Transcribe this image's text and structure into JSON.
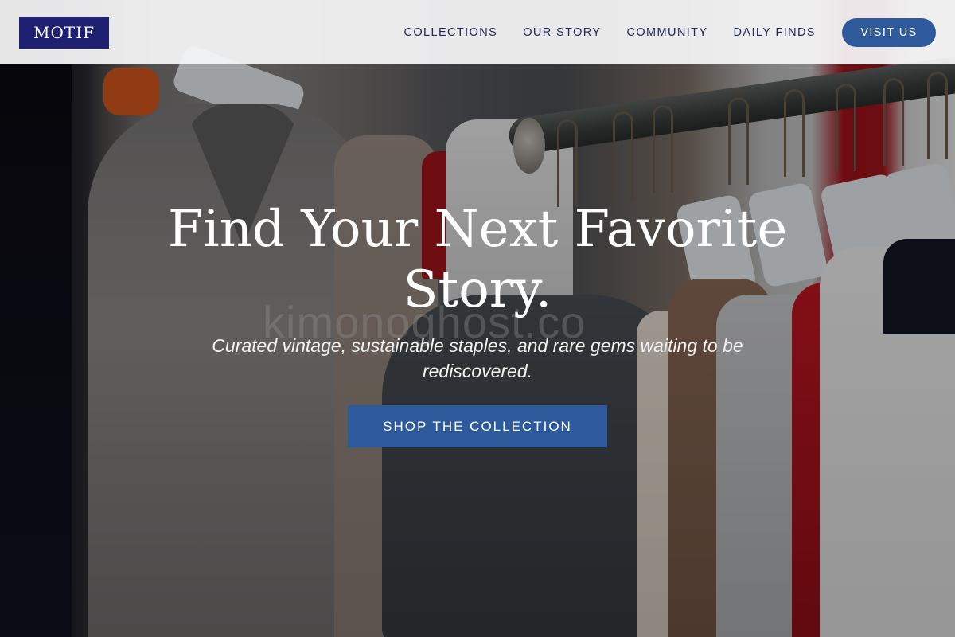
{
  "brand": {
    "logo_text": "MOTIF"
  },
  "nav": {
    "items": [
      {
        "label": "COLLECTIONS"
      },
      {
        "label": "OUR STORY"
      },
      {
        "label": "COMMUNITY"
      },
      {
        "label": "DAILY FINDS"
      }
    ],
    "cta_label": "VISIT US"
  },
  "hero": {
    "title": "Find Your Next Favorite Story.",
    "subtitle": "Curated vintage, sustainable staples, and rare gems waiting to be rediscovered.",
    "cta_label": "SHOP THE COLLECTION",
    "watermark": "kimonoghost.co"
  },
  "colors": {
    "brand_navy": "#1f2072",
    "accent_blue": "#2e5a9c",
    "header_bg": "#f4f4f5",
    "nav_text": "#23265e"
  }
}
